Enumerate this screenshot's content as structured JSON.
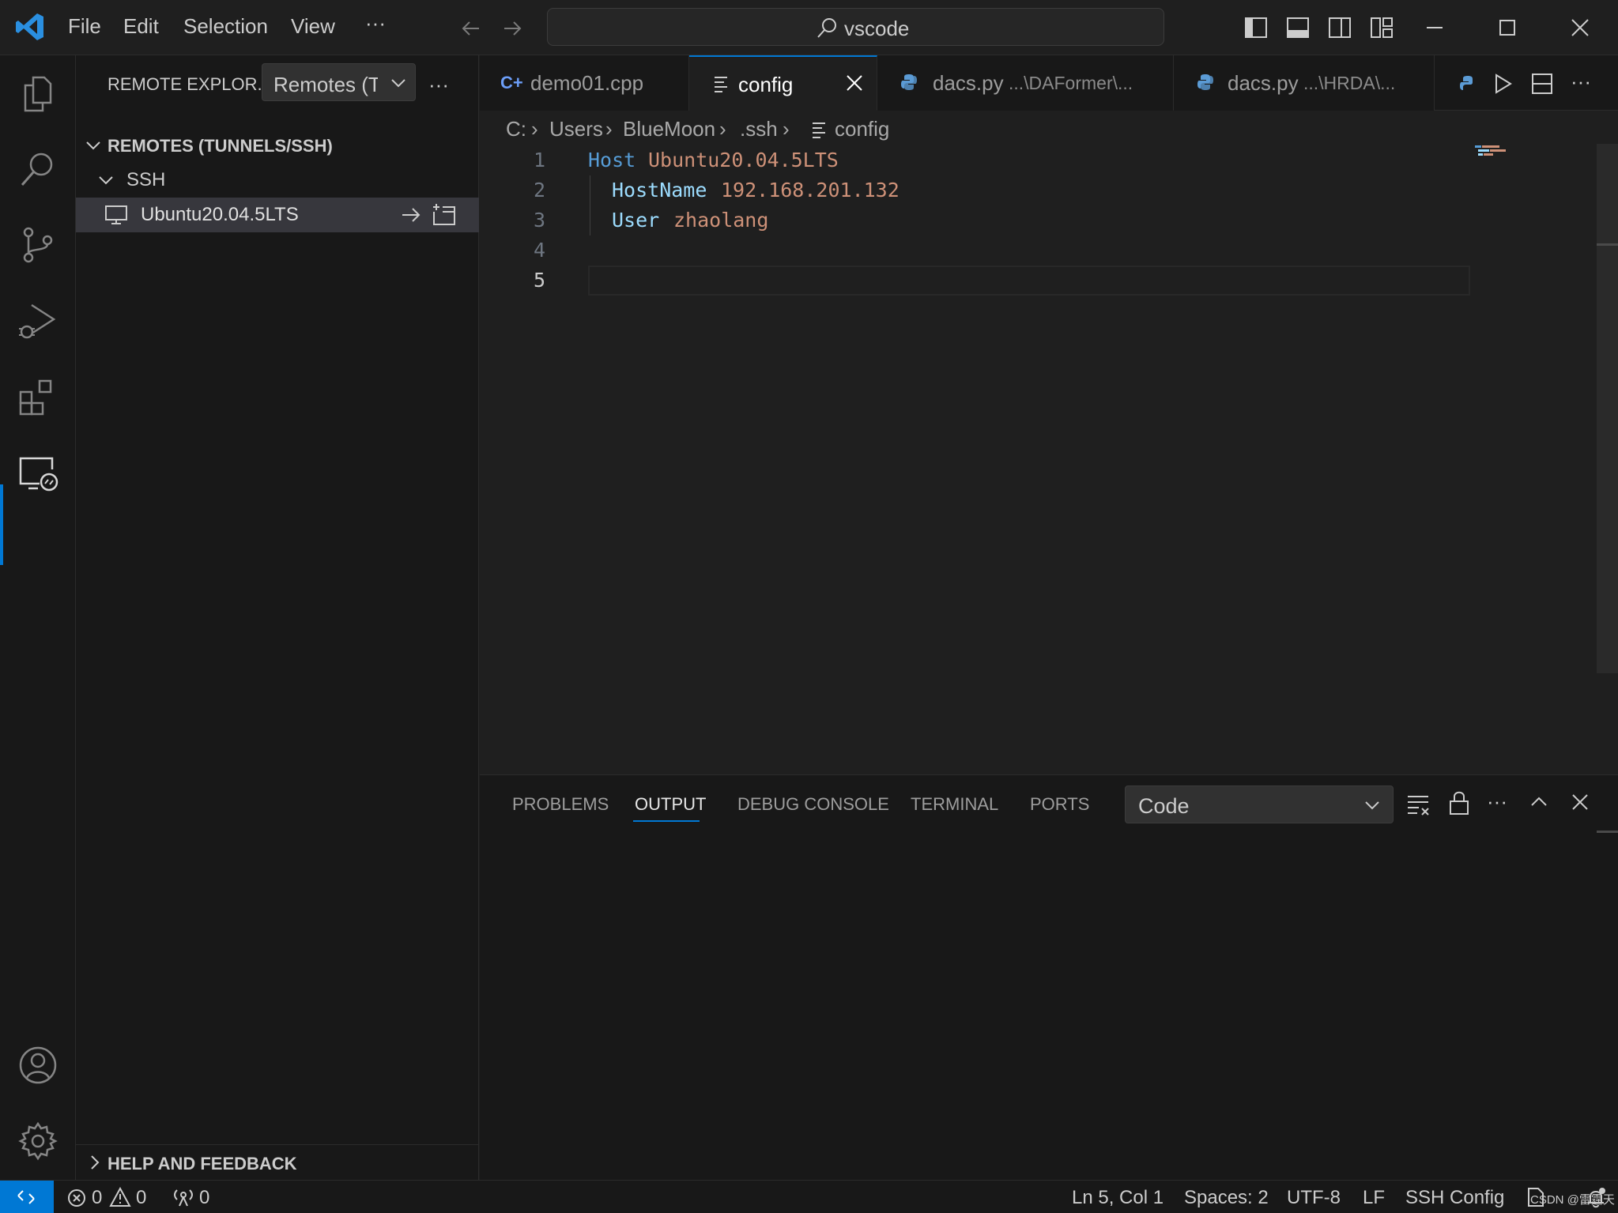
{
  "titlebar": {
    "menu": [
      "File",
      "Edit",
      "Selection",
      "View",
      "···"
    ],
    "search": "vscode"
  },
  "sidebar": {
    "title": "REMOTE EXPLOR...",
    "remote_select": "Remotes (Tunnels/SSH)",
    "section_title": "REMOTES (TUNNELS/SSH)",
    "group": "SSH",
    "host": "Ubuntu20.04.5LTS",
    "help_section": "HELP AND FEEDBACK"
  },
  "tabs": [
    {
      "label": "demo01.cpp",
      "desc": ""
    },
    {
      "label": "config",
      "desc": ""
    },
    {
      "label": "dacs.py",
      "desc": "...\\DAFormer\\..."
    },
    {
      "label": "dacs.py",
      "desc": "...\\HRDA\\..."
    }
  ],
  "breadcrumb": [
    "C:",
    "Users",
    "BlueMoon",
    ".ssh",
    "config"
  ],
  "editor": {
    "line_numbers": [
      "1",
      "2",
      "3",
      "4",
      "5"
    ],
    "line1": {
      "key": "Host",
      "value": "Ubuntu20.04.5LTS"
    },
    "line2": {
      "key": "HostName",
      "value": "192.168.201.132"
    },
    "line3": {
      "key": "User",
      "value": "zhaolang"
    }
  },
  "panel": {
    "tabs": [
      "PROBLEMS",
      "OUTPUT",
      "DEBUG CONSOLE",
      "TERMINAL",
      "PORTS"
    ],
    "output_channel": "Code"
  },
  "statusbar": {
    "errors": "0",
    "warnings": "0",
    "ports": "0",
    "position": "Ln 5, Col 1",
    "spaces": "Spaces: 2",
    "encoding": "UTF-8",
    "eol": "LF",
    "language": "SSH Config",
    "watermark": "CSDN @雷霆天"
  },
  "colors": {
    "accent": "#0078d4",
    "keyword": "#9cdcfe",
    "host_keyword": "#569cd6",
    "string": "#ce9178"
  }
}
